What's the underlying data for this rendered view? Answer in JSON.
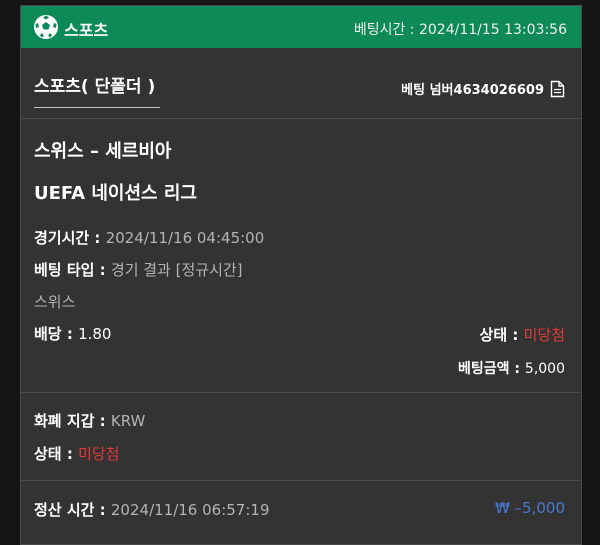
{
  "header": {
    "sport_label": "스포츠",
    "bet_time_label": "베팅시간",
    "bet_time_value": "2024/11/15 13:03:56"
  },
  "bet": {
    "title": "스포츠( 단폴더 )",
    "number_label": "베팅 넘버",
    "number_value": "4634026609"
  },
  "match": {
    "teams": "스위스 – 세르비아",
    "league": "UEFA 네이션스 리그"
  },
  "details": {
    "game_time_label": "경기시간",
    "game_time_value": "2024/11/16 04:45:00",
    "bet_type_label": "베팅 타입",
    "bet_type_value": "경기 결과 [정규시간]",
    "selection": "스위스",
    "odds_label": "배당",
    "odds_value": "1.80",
    "status_label": "상태",
    "status_value": "미당첨",
    "amount_label": "베팅금액",
    "amount_value": "5,000"
  },
  "summary": {
    "currency_label": "화폐 지갑",
    "currency_value": "KRW",
    "status_label": "상태",
    "status_value": "미당첨"
  },
  "settlement": {
    "label": "정산 시간",
    "time": "2024/11/16 06:57:19",
    "amount": "₩ –5,000"
  },
  "colors": {
    "header_green": "#0d8a57",
    "status_red": "#e23a3a",
    "amount_blue": "#4b78d6"
  }
}
